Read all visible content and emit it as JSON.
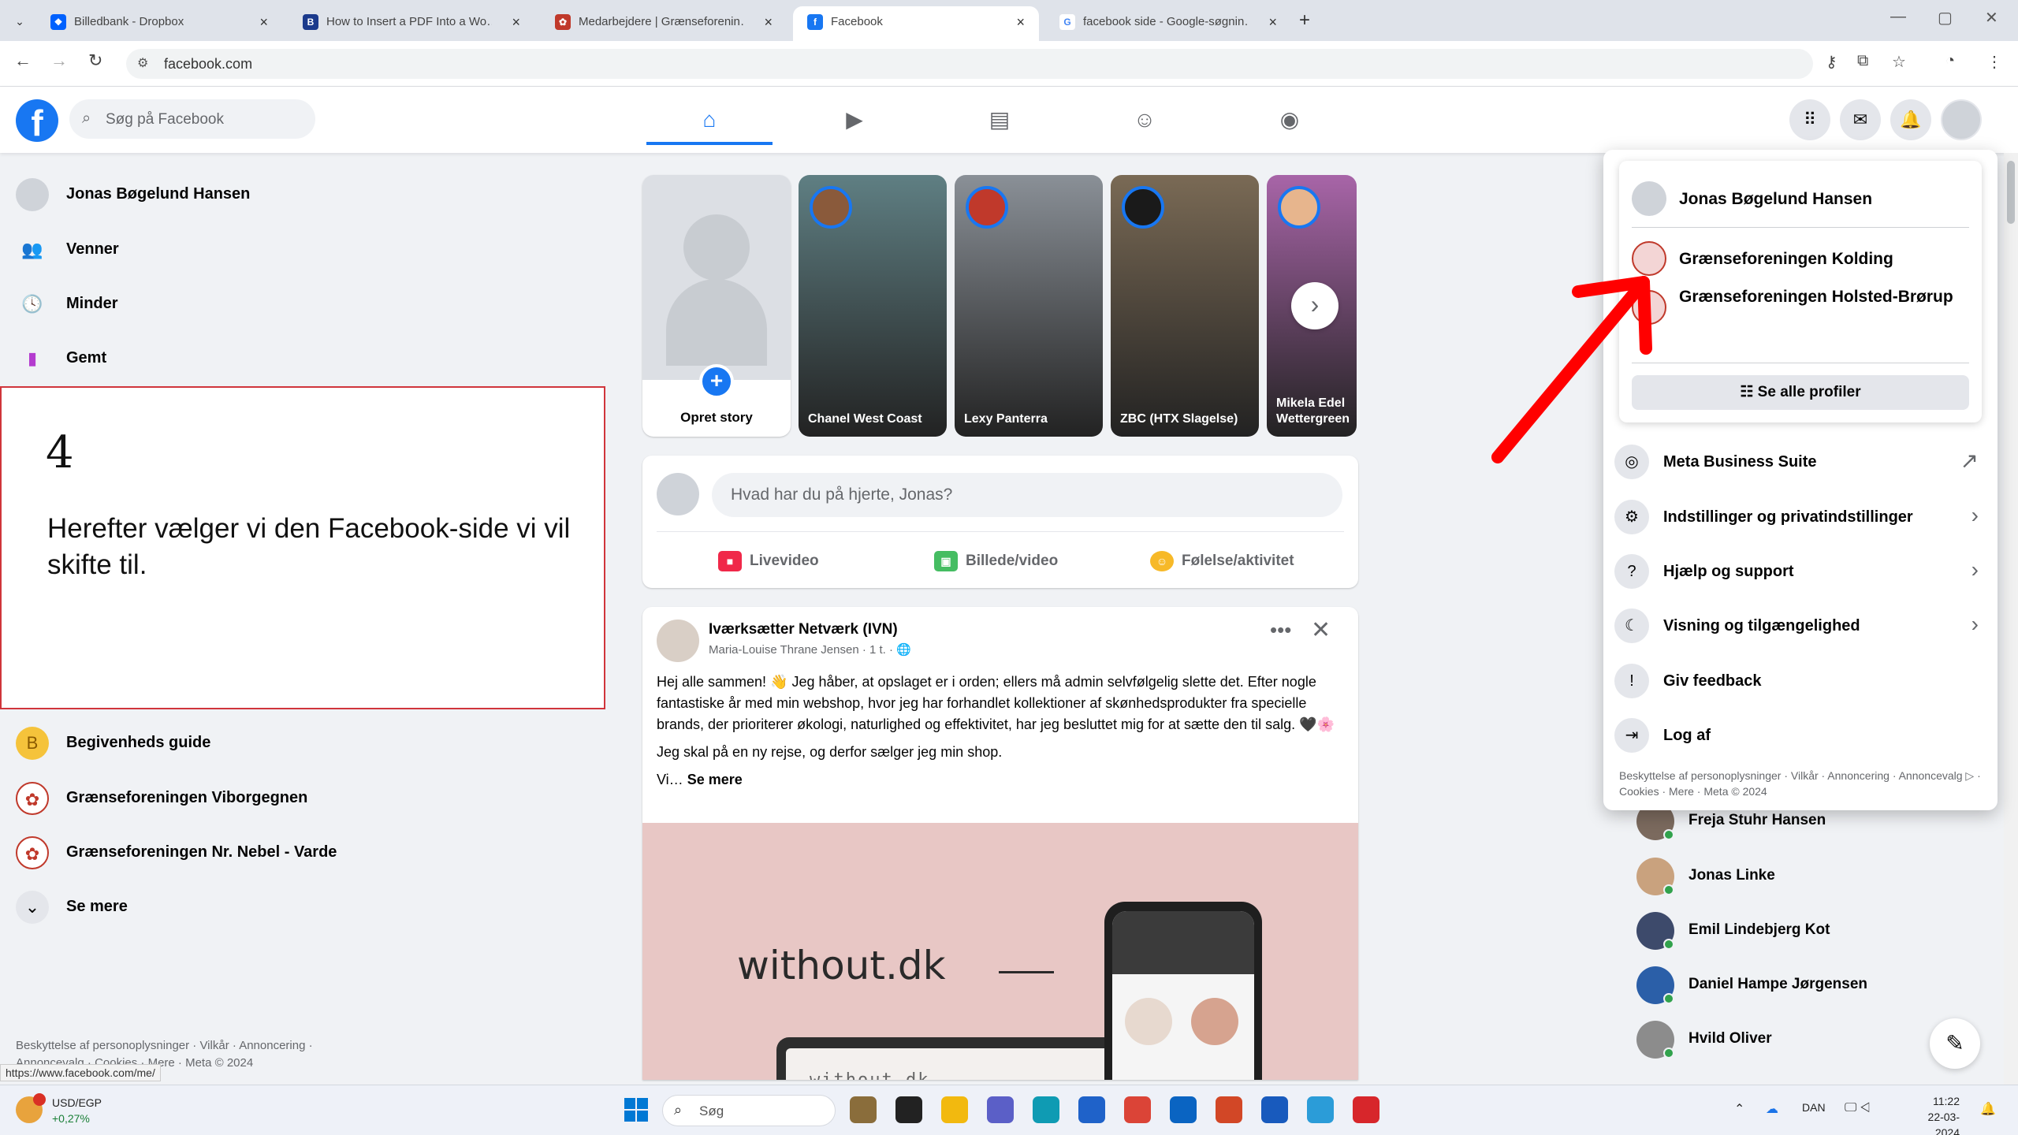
{
  "browser": {
    "tabs": [
      {
        "title": "Billedbank - Dropbox",
        "favicon_color": "#0061fe",
        "favicon_glyph": "❖"
      },
      {
        "title": "How to Insert a PDF Into a Wo…",
        "favicon_color": "#1b3a8c",
        "favicon_glyph": "B"
      },
      {
        "title": "Medarbejdere | Grænseforenin…",
        "favicon_color": "#c0392b",
        "favicon_glyph": "✿"
      },
      {
        "title": "Facebook",
        "favicon_color": "#1877f2",
        "favicon_glyph": "f"
      },
      {
        "title": "facebook side - Google-søgnin…",
        "favicon_color": "#ffffff",
        "favicon_glyph": "G"
      }
    ],
    "active_tab": 3,
    "url": "facebook.com",
    "status_url": "https://www.facebook.com/me/"
  },
  "fb": {
    "search_placeholder": "Søg på Facebook",
    "nav_tabs": [
      {
        "name": "home",
        "glyph": "⌂"
      },
      {
        "name": "video",
        "glyph": "▶"
      },
      {
        "name": "marketplace",
        "glyph": "▤"
      },
      {
        "name": "groups",
        "glyph": "☺"
      },
      {
        "name": "gaming",
        "glyph": "◉"
      }
    ],
    "header_icons": [
      {
        "name": "menu-grid-icon",
        "glyph": "⠿"
      },
      {
        "name": "messenger-icon",
        "glyph": "✉"
      },
      {
        "name": "notifications-icon",
        "glyph": "🔔"
      }
    ]
  },
  "left_sidebar": {
    "top_items": [
      {
        "label": "Jonas Bøgelund Hansen",
        "icon": "avatar-icon",
        "color": "#cfd3d9"
      },
      {
        "label": "Venner",
        "icon": "friends-icon",
        "color": "#1877f2"
      },
      {
        "label": "Minder",
        "icon": "memories-icon",
        "color": "#1877f2"
      },
      {
        "label": "Gemt",
        "icon": "saved-icon",
        "color": "#b43ccf"
      }
    ],
    "bottom_items": [
      {
        "label": "Begivenheds guide",
        "icon": "B",
        "color": "#f5c33b"
      },
      {
        "label": "Grænseforeningen Viborgegnen",
        "icon": "✿",
        "color": "#c0392b"
      },
      {
        "label": "Grænseforeningen Nr. Nebel - Varde",
        "icon": "✿",
        "color": "#c0392b"
      },
      {
        "label": "Se mere",
        "icon": "⌄",
        "color": "#e4e6eb"
      }
    ],
    "footer": "Beskyttelse af personoplysninger · Vilkår · Annoncering · Annoncevalg · Cookies · Mere · Meta © 2024"
  },
  "note": {
    "number": "4",
    "text": "Herefter vælger vi den Facebook-side vi vil skifte til."
  },
  "stories": {
    "create_label": "Opret story",
    "items": [
      {
        "name": "Chanel West Coast",
        "bg": "#5f7f83",
        "avatar": "#8a5a3b"
      },
      {
        "name": "Lexy Panterra",
        "bg": "#8a9097",
        "avatar": "#c0392b"
      },
      {
        "name": "ZBC (HTX Slagelse)",
        "bg": "#7a6a55",
        "avatar": "#1a1a1a"
      },
      {
        "name": "Mikela Edel Wettergreen",
        "bg": "#a865a8",
        "avatar": "#e7b58d"
      }
    ]
  },
  "composer": {
    "placeholder": "Hvad har du på hjerte, Jonas?",
    "actions": [
      {
        "label": "Livevideo",
        "color": "#f02849",
        "glyph": "■"
      },
      {
        "label": "Billede/video",
        "color": "#45bd62",
        "glyph": "▣"
      },
      {
        "label": "Følelse/aktivitet",
        "color": "#f7b928",
        "glyph": "☺"
      }
    ]
  },
  "post": {
    "author": "Iværksætter Netværk (IVN)",
    "subline": "Maria-Louise Thrane Jensen · 1 t. · 🌐",
    "paragraph1": "Hej alle sammen! 👋 Jeg håber, at opslaget er i orden; ellers må admin selvfølgelig slette det. Efter nogle fantastiske år med min webshop, hvor jeg har forhandlet kollektioner af skønhedsprodukter fra specielle brands, der prioriterer økologi, naturlighed og effektivitet, har jeg besluttet mig for at sætte den til salg. 🖤🌸",
    "paragraph2": "Jeg skal på en ny rejse, og derfor sælger jeg min shop.",
    "ellipsis": "Vi… ",
    "see_more": "Se mere",
    "wordmark": "without.dk",
    "laptop_text": "without.dk"
  },
  "dropdown": {
    "profiles": [
      {
        "name": "Jonas Bøgelund Hansen",
        "color": "#cfd3d9"
      },
      {
        "name": "Grænseforeningen Kolding",
        "color": "#f3d5d5"
      },
      {
        "name": "Grænseforeningen Holsted-Brørup",
        "color": "#f3d5d5"
      }
    ],
    "see_all": "Se alle profiler",
    "items": [
      {
        "label": "Meta Business Suite",
        "glyph": "◎",
        "chevron": "↗"
      },
      {
        "label": "Indstillinger og privatindstillinger",
        "glyph": "⚙",
        "chevron": "›"
      },
      {
        "label": "Hjælp og support",
        "glyph": "?",
        "chevron": "›"
      },
      {
        "label": "Visning og tilgængelighed",
        "glyph": "☾",
        "chevron": "›"
      },
      {
        "label": "Giv feedback",
        "glyph": "!",
        "chevron": ""
      },
      {
        "label": "Log af",
        "glyph": "⇥",
        "chevron": ""
      }
    ],
    "footer": "Beskyttelse af personoplysninger · Vilkår · Annoncering · Annoncevalg ▷ · Cookies · Mere · Meta © 2024"
  },
  "contacts": [
    {
      "name": "Freja Stuhr Hansen",
      "color": "#7b6a5e"
    },
    {
      "name": "Jonas Linke",
      "color": "#c9a27e"
    },
    {
      "name": "Emil Lindebjerg Kot",
      "color": "#3d4a6b"
    },
    {
      "name": "Daniel Hampe Jørgensen",
      "color": "#2b5fa8"
    },
    {
      "name": "Hvild Oliver",
      "color": "#8c8c8c"
    }
  ],
  "taskbar": {
    "ticker": "USD/EGP",
    "ticker_change": "+0,27%",
    "search_placeholder": "Søg",
    "language": "DAN",
    "time": "11:22",
    "date": "22-03-2024",
    "apps": [
      {
        "name": "taskbar-files-app",
        "color": "#8a6d3b"
      },
      {
        "name": "taskbar-taskview-app",
        "color": "#222222"
      },
      {
        "name": "taskbar-explorer-app",
        "color": "#f2b90f"
      },
      {
        "name": "taskbar-teams-app",
        "color": "#5b5fc7"
      },
      {
        "name": "taskbar-edge-app",
        "color": "#0f9bb3"
      },
      {
        "name": "taskbar-store-app",
        "color": "#1f62c9"
      },
      {
        "name": "taskbar-chrome-app",
        "color": "#db4437"
      },
      {
        "name": "taskbar-outlook-app",
        "color": "#0a64c2"
      },
      {
        "name": "taskbar-powerpoint-app",
        "color": "#d24726"
      },
      {
        "name": "taskbar-word-app",
        "color": "#185abd"
      },
      {
        "name": "taskbar-snip-app",
        "color": "#2b9cd8"
      },
      {
        "name": "taskbar-acrobat-app",
        "color": "#d7262b"
      }
    ]
  }
}
